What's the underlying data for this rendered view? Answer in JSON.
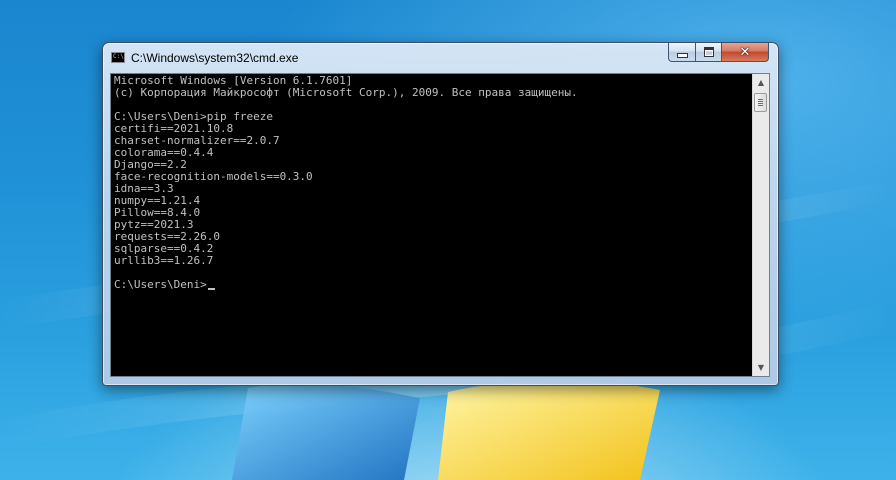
{
  "window": {
    "title": "C:\\Windows\\system32\\cmd.exe",
    "icon": "cmd-icon",
    "icon_text": "C:\\",
    "buttons": {
      "minimize": "minimize-icon",
      "maximize": "maximize-icon",
      "close": "close-icon",
      "close_glyph": "✕"
    }
  },
  "console": {
    "lines": [
      "Microsoft Windows [Version 6.1.7601]",
      "(c) Корпорация Майкрософт (Microsoft Corp.), 2009. Все права защищены.",
      "",
      "C:\\Users\\Deni>pip freeze",
      "certifi==2021.10.8",
      "charset-normalizer==2.0.7",
      "colorama==0.4.4",
      "Django==2.2",
      "face-recognition-models==0.3.0",
      "idna==3.3",
      "numpy==1.21.4",
      "Pillow==8.4.0",
      "pytz==2021.3",
      "requests==2.26.0",
      "sqlparse==0.4.2",
      "urllib3==1.26.7",
      ""
    ],
    "prompt": "C:\\Users\\Deni>",
    "text_color": "#c0c0c0",
    "background_color": "#000000"
  },
  "scrollbar": {
    "up_glyph": "▲",
    "down_glyph": "▼"
  },
  "desktop": {
    "background_color": "#1d7fc4",
    "logo": "windows-logo"
  }
}
